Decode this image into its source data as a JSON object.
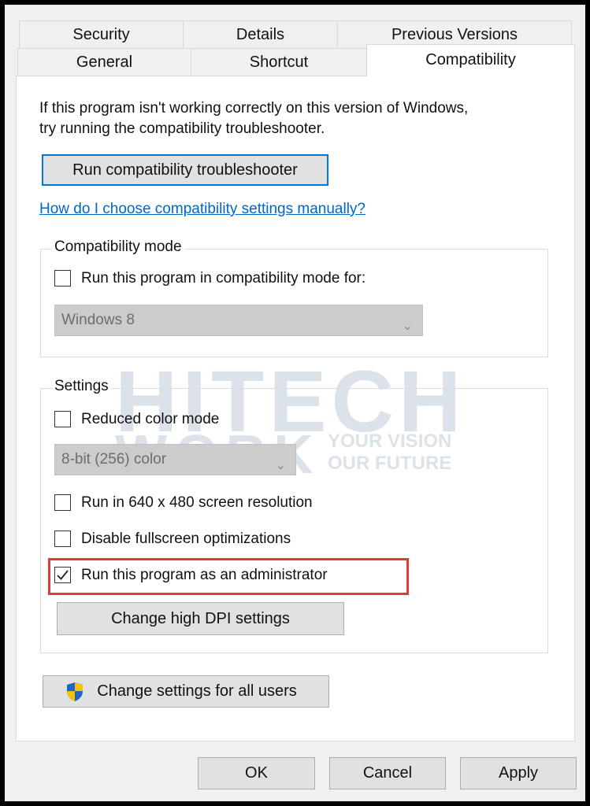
{
  "tabs_row1": [
    {
      "label": "Security"
    },
    {
      "label": "Details"
    },
    {
      "label": "Previous Versions"
    }
  ],
  "tabs_row2": [
    {
      "label": "General"
    },
    {
      "label": "Shortcut"
    },
    {
      "label": "Compatibility",
      "selected": true
    }
  ],
  "intro": {
    "line1": "If this program isn't working correctly on this version of Windows,",
    "line2": "try running the compatibility troubleshooter."
  },
  "troubleshooter_button": "Run compatibility troubleshooter",
  "help_link": "How do I choose compatibility settings manually?",
  "compat_mode": {
    "title": "Compatibility mode",
    "checkbox": {
      "label": "Run this program in compatibility mode for:",
      "checked": false
    },
    "select_value": "Windows 8"
  },
  "settings": {
    "title": "Settings",
    "reduced_color": {
      "label": "Reduced color mode",
      "checked": false
    },
    "color_select_value": "8-bit (256) color",
    "resolution": {
      "label": "Run in 640 x 480 screen resolution",
      "checked": false
    },
    "fullscreen": {
      "label": "Disable fullscreen optimizations",
      "checked": false
    },
    "admin": {
      "label": "Run this program as an administrator",
      "checked": true
    },
    "dpi_button": "Change high DPI settings"
  },
  "all_users_button": "Change settings for all users",
  "footer": {
    "ok": "OK",
    "cancel": "Cancel",
    "apply": "Apply"
  },
  "watermark": {
    "line1": "HITECH",
    "line2": "WORK",
    "tagline1": "YOUR VISION",
    "tagline2": "OUR FUTURE"
  },
  "colors": {
    "link": "#0066cc",
    "focus_border": "#0078d7",
    "highlight": "#e53935",
    "shield_blue": "#1e64c8",
    "shield_yellow": "#f5c400"
  }
}
